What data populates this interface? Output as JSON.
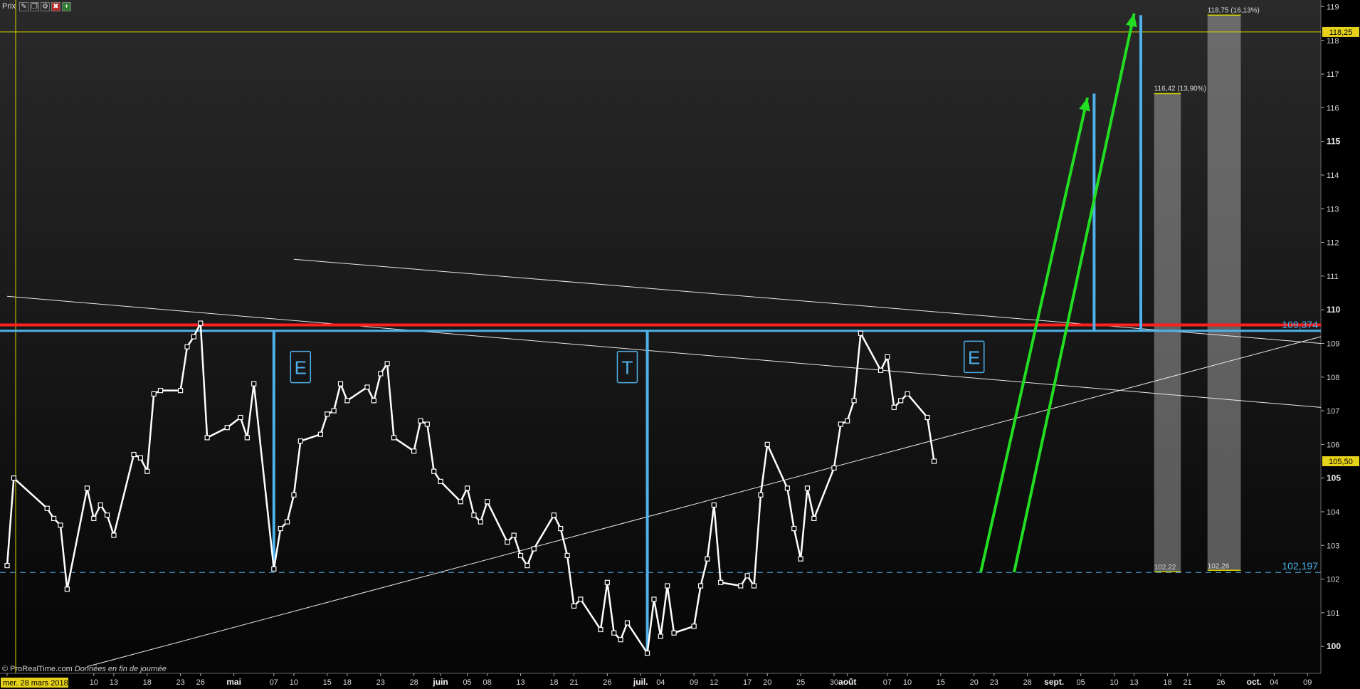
{
  "window": {
    "title": "Prix",
    "buttons": [
      {
        "name": "properties-icon",
        "glyph": "✎"
      },
      {
        "name": "layout-icon",
        "glyph": "❐"
      },
      {
        "name": "settings-icon",
        "glyph": "⚙"
      },
      {
        "name": "close-red-icon",
        "glyph": "✖"
      },
      {
        "name": "add-green-icon",
        "glyph": "+"
      }
    ]
  },
  "footer": {
    "source": "© ProRealTime.com",
    "note": "Données en fin de journée"
  },
  "chart_data": {
    "type": "line",
    "title": "",
    "xlabel": "",
    "ylabel": "",
    "ylim": [
      99.2,
      119.2
    ],
    "x_range": [
      "2018-03-28",
      "2018-10-11"
    ],
    "y_axis_side": "right",
    "grid": false,
    "y_ticks": [
      100,
      101,
      102,
      103,
      104,
      105,
      106,
      107,
      108,
      109,
      110,
      111,
      112,
      113,
      114,
      115,
      116,
      117,
      118,
      119
    ],
    "y_ticks_bold": [
      100,
      105,
      110,
      115
    ],
    "x_ticks": [
      {
        "date": "2018-03-28",
        "label": "mer. 28 mars 2018",
        "highlight": true
      },
      {
        "date": "2018-04-10",
        "label": "10"
      },
      {
        "date": "2018-04-13",
        "label": "13"
      },
      {
        "date": "2018-04-18",
        "label": "18"
      },
      {
        "date": "2018-04-23",
        "label": "23"
      },
      {
        "date": "2018-04-26",
        "label": "26"
      },
      {
        "date": "2018-05-01",
        "label": "mai",
        "bold": true
      },
      {
        "date": "2018-05-07",
        "label": "07"
      },
      {
        "date": "2018-05-10",
        "label": "10"
      },
      {
        "date": "2018-05-15",
        "label": "15"
      },
      {
        "date": "2018-05-18",
        "label": "18"
      },
      {
        "date": "2018-05-23",
        "label": "23"
      },
      {
        "date": "2018-05-28",
        "label": "28"
      },
      {
        "date": "2018-06-01",
        "label": "juin",
        "bold": true
      },
      {
        "date": "2018-06-05",
        "label": "05"
      },
      {
        "date": "2018-06-08",
        "label": "08"
      },
      {
        "date": "2018-06-13",
        "label": "13"
      },
      {
        "date": "2018-06-18",
        "label": "18"
      },
      {
        "date": "2018-06-21",
        "label": "21"
      },
      {
        "date": "2018-06-26",
        "label": "26"
      },
      {
        "date": "2018-07-01",
        "label": "juil.",
        "bold": true
      },
      {
        "date": "2018-07-04",
        "label": "04"
      },
      {
        "date": "2018-07-09",
        "label": "09"
      },
      {
        "date": "2018-07-12",
        "label": "12"
      },
      {
        "date": "2018-07-17",
        "label": "17"
      },
      {
        "date": "2018-07-20",
        "label": "20"
      },
      {
        "date": "2018-07-25",
        "label": "25"
      },
      {
        "date": "2018-07-30",
        "label": "30"
      },
      {
        "date": "2018-08-01",
        "label": "août",
        "bold": true
      },
      {
        "date": "2018-08-07",
        "label": "07"
      },
      {
        "date": "2018-08-10",
        "label": "10"
      },
      {
        "date": "2018-08-15",
        "label": "15"
      },
      {
        "date": "2018-08-20",
        "label": "20"
      },
      {
        "date": "2018-08-23",
        "label": "23"
      },
      {
        "date": "2018-08-28",
        "label": "28"
      },
      {
        "date": "2018-09-01",
        "label": "sept.",
        "bold": true
      },
      {
        "date": "2018-09-05",
        "label": "05"
      },
      {
        "date": "2018-09-10",
        "label": "10"
      },
      {
        "date": "2018-09-13",
        "label": "13"
      },
      {
        "date": "2018-09-18",
        "label": "18"
      },
      {
        "date": "2018-09-21",
        "label": "21"
      },
      {
        "date": "2018-09-26",
        "label": "26"
      },
      {
        "date": "2018-10-01",
        "label": "oct.",
        "bold": true
      },
      {
        "date": "2018-10-04",
        "label": "04"
      },
      {
        "date": "2018-10-09",
        "label": "09"
      }
    ],
    "series": [
      {
        "color": "#ffffff",
        "points": [
          [
            "2018-03-28",
            102.4
          ],
          [
            "2018-03-29",
            105.0
          ],
          [
            "2018-04-03",
            104.1
          ],
          [
            "2018-04-04",
            103.8
          ],
          [
            "2018-04-05",
            103.6
          ],
          [
            "2018-04-06",
            101.7
          ],
          [
            "2018-04-09",
            104.7
          ],
          [
            "2018-04-10",
            103.8
          ],
          [
            "2018-04-11",
            104.2
          ],
          [
            "2018-04-12",
            103.9
          ],
          [
            "2018-04-13",
            103.3
          ],
          [
            "2018-04-16",
            105.7
          ],
          [
            "2018-04-17",
            105.6
          ],
          [
            "2018-04-18",
            105.2
          ],
          [
            "2018-04-19",
            107.5
          ],
          [
            "2018-04-20",
            107.6
          ],
          [
            "2018-04-23",
            107.6
          ],
          [
            "2018-04-24",
            108.9
          ],
          [
            "2018-04-25",
            109.2
          ],
          [
            "2018-04-26",
            109.6
          ],
          [
            "2018-04-27",
            106.2
          ],
          [
            "2018-04-30",
            106.5
          ],
          [
            "2018-05-02",
            106.8
          ],
          [
            "2018-05-03",
            106.2
          ],
          [
            "2018-05-04",
            107.8
          ],
          [
            "2018-05-07",
            102.3
          ],
          [
            "2018-05-08",
            103.5
          ],
          [
            "2018-05-09",
            103.7
          ],
          [
            "2018-05-10",
            104.5
          ],
          [
            "2018-05-11",
            106.1
          ],
          [
            "2018-05-14",
            106.3
          ],
          [
            "2018-05-15",
            106.9
          ],
          [
            "2018-05-16",
            107.0
          ],
          [
            "2018-05-17",
            107.8
          ],
          [
            "2018-05-18",
            107.3
          ],
          [
            "2018-05-21",
            107.7
          ],
          [
            "2018-05-22",
            107.3
          ],
          [
            "2018-05-23",
            108.1
          ],
          [
            "2018-05-24",
            108.4
          ],
          [
            "2018-05-25",
            106.2
          ],
          [
            "2018-05-28",
            105.8
          ],
          [
            "2018-05-29",
            106.7
          ],
          [
            "2018-05-30",
            106.6
          ],
          [
            "2018-05-31",
            105.2
          ],
          [
            "2018-06-01",
            104.9
          ],
          [
            "2018-06-04",
            104.3
          ],
          [
            "2018-06-05",
            104.7
          ],
          [
            "2018-06-06",
            103.9
          ],
          [
            "2018-06-07",
            103.7
          ],
          [
            "2018-06-08",
            104.3
          ],
          [
            "2018-06-11",
            103.1
          ],
          [
            "2018-06-12",
            103.3
          ],
          [
            "2018-06-13",
            102.7
          ],
          [
            "2018-06-14",
            102.4
          ],
          [
            "2018-06-15",
            102.9
          ],
          [
            "2018-06-18",
            103.9
          ],
          [
            "2018-06-19",
            103.5
          ],
          [
            "2018-06-20",
            102.7
          ],
          [
            "2018-06-21",
            101.2
          ],
          [
            "2018-06-22",
            101.4
          ],
          [
            "2018-06-25",
            100.5
          ],
          [
            "2018-06-26",
            101.9
          ],
          [
            "2018-06-27",
            100.4
          ],
          [
            "2018-06-28",
            100.2
          ],
          [
            "2018-06-29",
            100.7
          ],
          [
            "2018-07-02",
            99.8
          ],
          [
            "2018-07-03",
            101.4
          ],
          [
            "2018-07-04",
            100.3
          ],
          [
            "2018-07-05",
            101.8
          ],
          [
            "2018-07-06",
            100.4
          ],
          [
            "2018-07-09",
            100.6
          ],
          [
            "2018-07-10",
            101.8
          ],
          [
            "2018-07-11",
            102.6
          ],
          [
            "2018-07-12",
            104.2
          ],
          [
            "2018-07-13",
            101.9
          ],
          [
            "2018-07-16",
            101.8
          ],
          [
            "2018-07-17",
            102.1
          ],
          [
            "2018-07-18",
            101.8
          ],
          [
            "2018-07-19",
            104.5
          ],
          [
            "2018-07-20",
            106.0
          ],
          [
            "2018-07-23",
            104.7
          ],
          [
            "2018-07-24",
            103.5
          ],
          [
            "2018-07-25",
            102.6
          ],
          [
            "2018-07-26",
            104.7
          ],
          [
            "2018-07-27",
            103.8
          ],
          [
            "2018-07-30",
            105.3
          ],
          [
            "2018-07-31",
            106.6
          ],
          [
            "2018-08-01",
            106.7
          ],
          [
            "2018-08-02",
            107.3
          ],
          [
            "2018-08-03",
            109.3
          ],
          [
            "2018-08-06",
            108.2
          ],
          [
            "2018-08-07",
            108.6
          ],
          [
            "2018-08-08",
            107.1
          ],
          [
            "2018-08-09",
            107.3
          ],
          [
            "2018-08-10",
            107.5
          ],
          [
            "2018-08-13",
            106.8
          ],
          [
            "2018-08-14",
            105.5
          ]
        ]
      }
    ],
    "price_tag": {
      "value": 105.5,
      "label": "105,50"
    },
    "hline_yellow": {
      "value": 118.25,
      "label": "118,25",
      "color": "#d4d400"
    },
    "vline_yellow": {
      "date": "2018-03-28",
      "color": "#d4d400"
    },
    "hline_red": {
      "value": 109.55,
      "color": "#ff1f1f"
    },
    "hline_blue": {
      "value": 109.374,
      "label": "109,374",
      "color": "#4fb0ea"
    },
    "hline_dashed": {
      "value": 102.197,
      "label": "102,197",
      "color": "#4fb0ea"
    },
    "trendlines": [
      {
        "from": [
          "2018-03-28",
          110.4
        ],
        "to": [
          "2018-10-11",
          107.1
        ],
        "color": "#e8e8e8"
      },
      {
        "from": [
          "2018-05-10",
          111.5
        ],
        "to": [
          "2018-10-11",
          109.0
        ],
        "color": "#e8e8e8"
      },
      {
        "from": [
          "2018-04-09",
          99.4
        ],
        "to": [
          "2018-10-11",
          109.2
        ],
        "color": "#e8e8e8"
      }
    ],
    "blue_vlines": [
      {
        "date": "2018-05-07",
        "from": 109.374,
        "to": 102.3
      },
      {
        "date": "2018-07-02",
        "from": 109.374,
        "to": 99.8
      },
      {
        "date": "2018-09-07",
        "from": 109.374,
        "to": 116.42
      },
      {
        "date": "2018-09-14",
        "from": 109.374,
        "to": 118.75
      }
    ],
    "green_arrows": [
      {
        "from": [
          "2018-08-21",
          102.2
        ],
        "to": [
          "2018-09-06",
          116.3
        ]
      },
      {
        "from": [
          "2018-08-26",
          102.2
        ],
        "to": [
          "2018-09-13",
          118.8
        ]
      }
    ],
    "boxes": [
      {
        "label": "E",
        "date": "2018-05-11",
        "value": 108.3
      },
      {
        "label": "T",
        "date": "2018-06-29",
        "value": 108.3
      },
      {
        "label": "E",
        "date": "2018-08-20",
        "value": 108.6
      }
    ],
    "projection_bars": [
      {
        "date_from": "2018-09-16",
        "date_to": "2018-09-20",
        "low": 102.22,
        "high": 116.42,
        "low_label": "102,22",
        "high_label": "116,42 (13,90%)"
      },
      {
        "date_from": "2018-09-24",
        "date_to": "2018-09-29",
        "low": 102.26,
        "high": 118.75,
        "low_label": "102,26",
        "high_label": "118,75 (16,13%)"
      }
    ]
  }
}
